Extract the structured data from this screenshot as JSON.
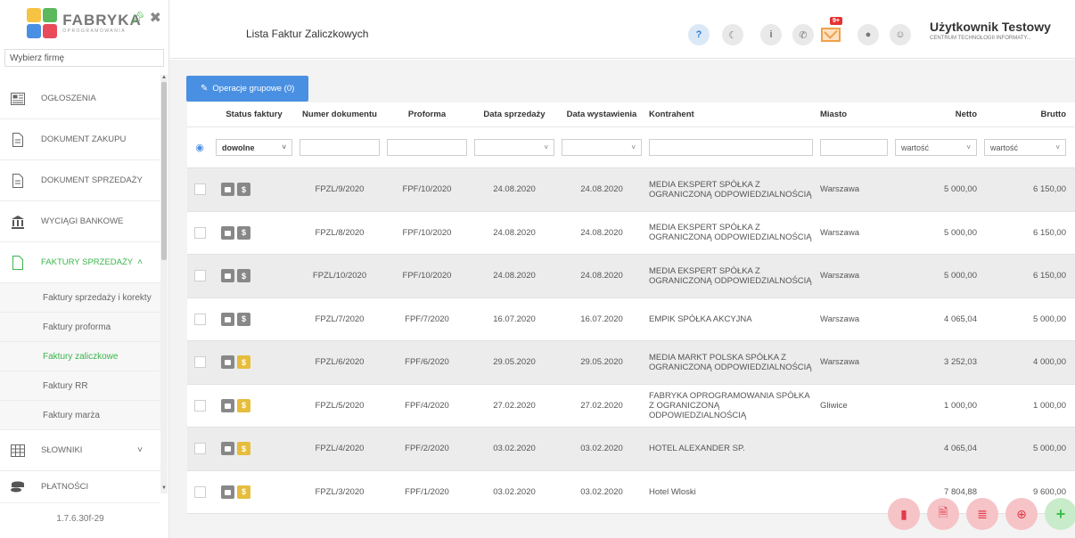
{
  "sidebar": {
    "logo_text": "FABRYKA",
    "logo_subtext": "OPROGRAMOWANIA",
    "firm_placeholder": "Wybierz firmę",
    "items": [
      {
        "label": "OGŁOSZENIA",
        "icon": "newspaper-icon"
      },
      {
        "label": "DOKUMENT ZAKUPU",
        "icon": "document-icon"
      },
      {
        "label": "DOKUMENT SPRZEDAŻY",
        "icon": "document-icon"
      },
      {
        "label": "WYCIĄGI BANKOWE",
        "icon": "bank-icon"
      },
      {
        "label": "FAKTURY SPRZEDAŻY",
        "icon": "file-icon",
        "active": true
      }
    ],
    "subitems": [
      {
        "label": "Faktury sprzedaży i korekty"
      },
      {
        "label": "Faktury proforma"
      },
      {
        "label": "Faktury zaliczkowe",
        "active": true
      },
      {
        "label": "Faktury RR"
      },
      {
        "label": "Faktury marża"
      }
    ],
    "items_after": [
      {
        "label": "SŁOWNIKI",
        "icon": "table-icon"
      },
      {
        "label": "PŁATNOŚCI",
        "icon": "coins-icon"
      }
    ],
    "version": "1.7.6.30f-29"
  },
  "header": {
    "title": "Lista Faktur Zaliczkowych",
    "mail_badge": "9+",
    "user_name": "Użytkownik Testowy",
    "user_company": "CENTRUM TECHNOLOGII INFORMATY..."
  },
  "toolbar": {
    "bulk_label": "Operacje grupowe (0)"
  },
  "table": {
    "columns": [
      "Status faktury",
      "Numer dokumentu",
      "Proforma",
      "Data sprzedaży",
      "Data wystawienia",
      "Kontrahent",
      "Miasto",
      "Netto",
      "Brutto"
    ],
    "filters": {
      "status": "dowolne",
      "netto": "wartość",
      "brutto": "wartość"
    },
    "rows": [
      {
        "numer": "FPZL/9/2020",
        "proforma": "FPF/10/2020",
        "data_sprzedazy": "24.08.2020",
        "data_wystawienia": "24.08.2020",
        "kontrahent": "MEDIA EKSPERT SPÓŁKA Z OGRANICZONĄ ODPOWIEDZIALNOŚCIĄ",
        "miasto": "Warszawa",
        "netto": "5 000,00",
        "brutto": "6 150,00",
        "paid": false
      },
      {
        "numer": "FPZL/8/2020",
        "proforma": "FPF/10/2020",
        "data_sprzedazy": "24.08.2020",
        "data_wystawienia": "24.08.2020",
        "kontrahent": "MEDIA EKSPERT SPÓŁKA Z OGRANICZONĄ ODPOWIEDZIALNOŚCIĄ",
        "miasto": "Warszawa",
        "netto": "5 000,00",
        "brutto": "6 150,00",
        "paid": false
      },
      {
        "numer": "FPZL/10/2020",
        "proforma": "FPF/10/2020",
        "data_sprzedazy": "24.08.2020",
        "data_wystawienia": "24.08.2020",
        "kontrahent": "MEDIA EKSPERT SPÓŁKA Z OGRANICZONĄ ODPOWIEDZIALNOŚCIĄ",
        "miasto": "Warszawa",
        "netto": "5 000,00",
        "brutto": "6 150,00",
        "paid": false
      },
      {
        "numer": "FPZL/7/2020",
        "proforma": "FPF/7/2020",
        "data_sprzedazy": "16.07.2020",
        "data_wystawienia": "16.07.2020",
        "kontrahent": "EMPIK SPÓŁKA AKCYJNA",
        "miasto": "Warszawa",
        "netto": "4 065,04",
        "brutto": "5 000,00",
        "paid": false
      },
      {
        "numer": "FPZL/6/2020",
        "proforma": "FPF/6/2020",
        "data_sprzedazy": "29.05.2020",
        "data_wystawienia": "29.05.2020",
        "kontrahent": "MEDIA MARKT POLSKA SPÓŁKA Z OGRANICZONĄ ODPOWIEDZIALNOŚCIĄ",
        "miasto": "Warszawa",
        "netto": "3 252,03",
        "brutto": "4 000,00",
        "paid": true
      },
      {
        "numer": "FPZL/5/2020",
        "proforma": "FPF/4/2020",
        "data_sprzedazy": "27.02.2020",
        "data_wystawienia": "27.02.2020",
        "kontrahent": "FABRYKA OPROGRAMOWANIA SPÓŁKA Z OGRANICZONĄ ODPOWIEDZIALNOŚCIĄ",
        "miasto": "Gliwice",
        "netto": "1 000,00",
        "brutto": "1 000,00",
        "paid": true
      },
      {
        "numer": "FPZL/4/2020",
        "proforma": "FPF/2/2020",
        "data_sprzedazy": "03.02.2020",
        "data_wystawienia": "03.02.2020",
        "kontrahent": "HOTEL ALEXANDER SP.",
        "miasto": "",
        "netto": "4 065,04",
        "brutto": "5 000,00",
        "paid": true
      },
      {
        "numer": "FPZL/3/2020",
        "proforma": "FPF/1/2020",
        "data_sprzedazy": "03.02.2020",
        "data_wystawienia": "03.02.2020",
        "kontrahent": "Hotel Wloski",
        "miasto": "",
        "netto": "7 804,88",
        "brutto": "9 600,00",
        "paid": true
      }
    ]
  },
  "colors": {
    "accent_green": "#39b54a",
    "button_blue": "#4a90e2",
    "fab_red": "#e23b4a"
  }
}
